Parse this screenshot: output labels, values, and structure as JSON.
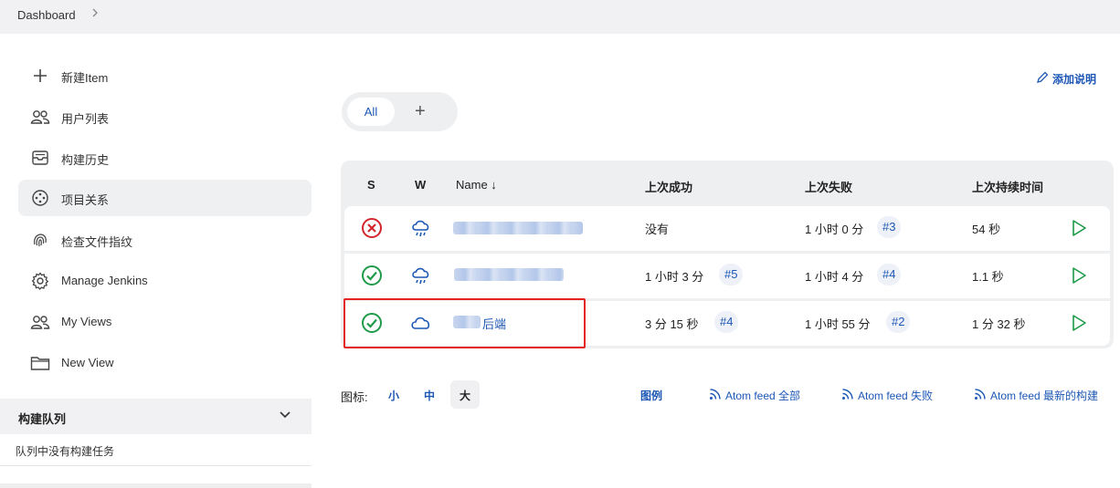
{
  "breadcrumb": {
    "root": "Dashboard"
  },
  "sidebar": {
    "items": [
      {
        "label": "新建Item",
        "icon": "plus-icon"
      },
      {
        "label": "用户列表",
        "icon": "users-icon"
      },
      {
        "label": "构建历史",
        "icon": "inbox-icon"
      },
      {
        "label": "项目关系",
        "icon": "project-relationship-icon",
        "active": true
      },
      {
        "label": "检查文件指纹",
        "icon": "fingerprint-icon"
      },
      {
        "label": "Manage Jenkins",
        "icon": "gear-icon"
      },
      {
        "label": "My Views",
        "icon": "users-icon"
      },
      {
        "label": "New View",
        "icon": "folder-icon"
      }
    ],
    "queue": {
      "title": "构建队列",
      "empty_text": "队列中没有构建任务"
    }
  },
  "main": {
    "add_description": "添加说明",
    "tabs": {
      "all": "All",
      "add": "+"
    },
    "table": {
      "headers": {
        "s": "S",
        "w": "W",
        "name": "Name ↓",
        "last_success": "上次成功",
        "last_failure": "上次失败",
        "last_duration": "上次持续时间"
      },
      "rows": [
        {
          "status": "failed",
          "weather": "rain-cloud-icon",
          "name": "",
          "last_success": "没有",
          "last_success_build": "",
          "last_failure": "1 小时 0 分",
          "last_failure_build": "#3",
          "duration": "54 秒"
        },
        {
          "status": "success",
          "weather": "rain-cloud-icon",
          "name": "",
          "last_success": "1 小时 3 分",
          "last_success_build": "#5",
          "last_failure": "1 小时 4 分",
          "last_failure_build": "#4",
          "duration": "1.1 秒"
        },
        {
          "status": "success",
          "weather": "cloud-icon",
          "name": "后端",
          "last_success": "3 分 15 秒",
          "last_success_build": "#4",
          "last_failure": "1 小时 55 分",
          "last_failure_build": "#2",
          "duration": "1 分 32 秒"
        }
      ]
    },
    "footer": {
      "icon_label": "图标:",
      "sizes": [
        "小",
        "中",
        "大"
      ],
      "active_size": "大",
      "legend": "图例",
      "feed_all": "Atom feed 全部",
      "feed_failed": "Atom feed 失败",
      "feed_latest": "Atom feed 最新的构建"
    }
  },
  "colors": {
    "link": "#1d57b5",
    "success": "#1f9a4a",
    "failure": "#d2262c",
    "highlight": "#e52222"
  }
}
